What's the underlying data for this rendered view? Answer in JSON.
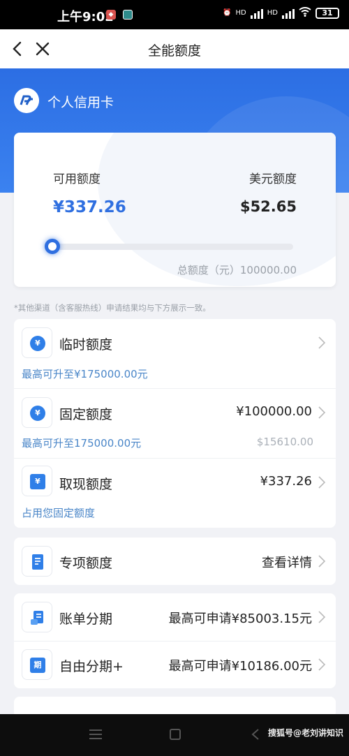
{
  "status_bar": {
    "time": "上午9:02",
    "battery": "31",
    "hd1": "HD",
    "hd2": "HD"
  },
  "navbar": {
    "title": "全能额度"
  },
  "card": {
    "name": "个人信用卡",
    "available_label": "可用额度",
    "available_value": "¥337.26",
    "usd_label": "美元额度",
    "usd_value": "$52.65",
    "total_label": "总额度（元）100000.00",
    "usage_fraction": 0.0034
  },
  "note": "*其他渠道（含客服热线）申请结果均与下方展示一致。",
  "limits": [
    {
      "label": "临时额度",
      "value": "",
      "sub": "最高可升至¥175000.00元",
      "sub2": "",
      "icon": "yuan-bubble-icon"
    },
    {
      "label": "固定额度",
      "value": "¥100000.00",
      "sub": "最高可升至175000.00元",
      "sub2": "$15610.00",
      "icon": "yuan-cycle-icon"
    },
    {
      "label": "取现额度",
      "value": "¥337.26",
      "sub": "占用您固定额度",
      "sub2": "",
      "icon": "cash-icon"
    }
  ],
  "special": {
    "label": "专项额度",
    "value": "查看详情",
    "icon": "document-icon"
  },
  "installments": [
    {
      "label": "账单分期",
      "value": "最高可申请¥85003.15元",
      "icon": "bill-icon"
    },
    {
      "label": "自由分期+",
      "value": "最高可申请¥10186.00元",
      "icon": "period-icon",
      "icon_text": "期"
    }
  ],
  "watermark": "搜狐号@老刘讲知识",
  "colors": {
    "primary": "#2f6fe0",
    "link": "#4a86c8",
    "background": "#f1f2f6"
  }
}
